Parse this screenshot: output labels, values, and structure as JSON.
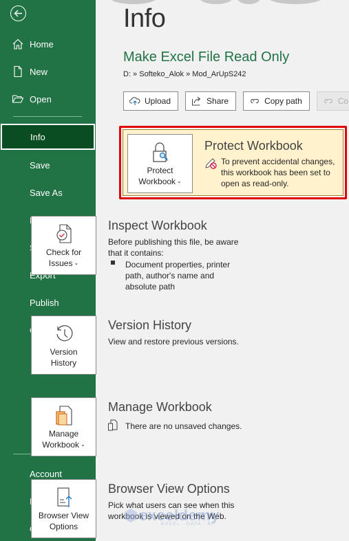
{
  "sidebar": {
    "back_label": "Back",
    "top_items": [
      {
        "label": "Home",
        "icon": "home-icon"
      },
      {
        "label": "New",
        "icon": "new-document-icon"
      },
      {
        "label": "Open",
        "icon": "folder-open-icon"
      }
    ],
    "middle_items": [
      {
        "label": "Info",
        "active": true
      },
      {
        "label": "Save"
      },
      {
        "label": "Save As"
      },
      {
        "label": "Print"
      },
      {
        "label": "Share"
      },
      {
        "label": "Export"
      },
      {
        "label": "Publish"
      },
      {
        "label": "Close"
      }
    ],
    "bottom_items": [
      {
        "label": "Account"
      },
      {
        "label": "Feedback"
      },
      {
        "label": "Options"
      }
    ]
  },
  "main": {
    "page_title": "Info",
    "file_title": "Make Excel File Read Only",
    "breadcrumb": "D: » Softeko_Alok » Mod_ArUpS242",
    "toolbar": [
      {
        "label": "Upload",
        "icon": "cloud-upload-icon"
      },
      {
        "label": "Share",
        "icon": "share-icon"
      },
      {
        "label": "Copy path",
        "icon": "link-icon"
      },
      {
        "label": "Co",
        "icon": "link-icon",
        "disabled": true
      }
    ],
    "sections": {
      "protect": {
        "button_line1": "Protect",
        "button_line2": "Workbook",
        "title": "Protect Workbook",
        "description": "To prevent accidental changes, this workbook has been set to open as read-only.",
        "highlight_color": "#e00000",
        "background_color": "#fff2cc"
      },
      "inspect": {
        "button_line1": "Check for",
        "button_line2": "Issues",
        "title": "Inspect Workbook",
        "description": "Before publishing this file, be aware that it contains:",
        "bullets": [
          "Document properties, printer path, author's name and absolute path"
        ]
      },
      "version": {
        "button_line1": "Version",
        "button_line2": "History",
        "title": "Version History",
        "description": "View and restore previous versions."
      },
      "manage": {
        "button_line1": "Manage",
        "button_line2": "Workbook",
        "title": "Manage Workbook",
        "description": "There are no unsaved changes."
      },
      "browser": {
        "button_line1": "Browser View",
        "button_line2": "Options",
        "title": "Browser View Options",
        "description": "Pick what users can see when this workbook is viewed on the Web."
      }
    }
  },
  "watermark": {
    "text": "exceldemy",
    "subtext": "EXCEL · DATA · BI"
  },
  "colors": {
    "brand_green": "#217346",
    "active_nav": "#0b4d22",
    "highlight_red": "#e00000"
  }
}
